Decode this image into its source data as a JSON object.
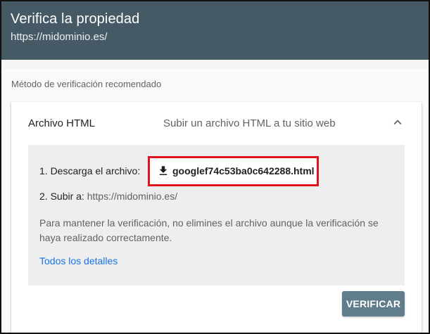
{
  "header": {
    "title": "Verifica la propiedad",
    "subtitle": "https://midominio.es/"
  },
  "section": {
    "label": "Método de verificación recomendado"
  },
  "card": {
    "title": "Archivo HTML",
    "description": "Subir un archivo HTML a tu sitio web",
    "collapse_icon": "chevron-up-icon",
    "step1_label": "1. Descarga el archivo:",
    "download_filename": "googlef74c53ba0c642288.html",
    "download_icon": "download-icon",
    "step2_label": "2. Subir a:",
    "step2_url": "https://midominio.es/",
    "note": "Para mantener la verificación, no elimines el archivo aunque la verificación se haya realizado correctamente.",
    "details_link": "Todos los detalles",
    "verify_button": "VERIFICAR"
  },
  "colors": {
    "header_bg": "#455a64",
    "button_bg": "#607d8b",
    "link": "#1a73e8",
    "highlight_border": "#e0141c"
  }
}
